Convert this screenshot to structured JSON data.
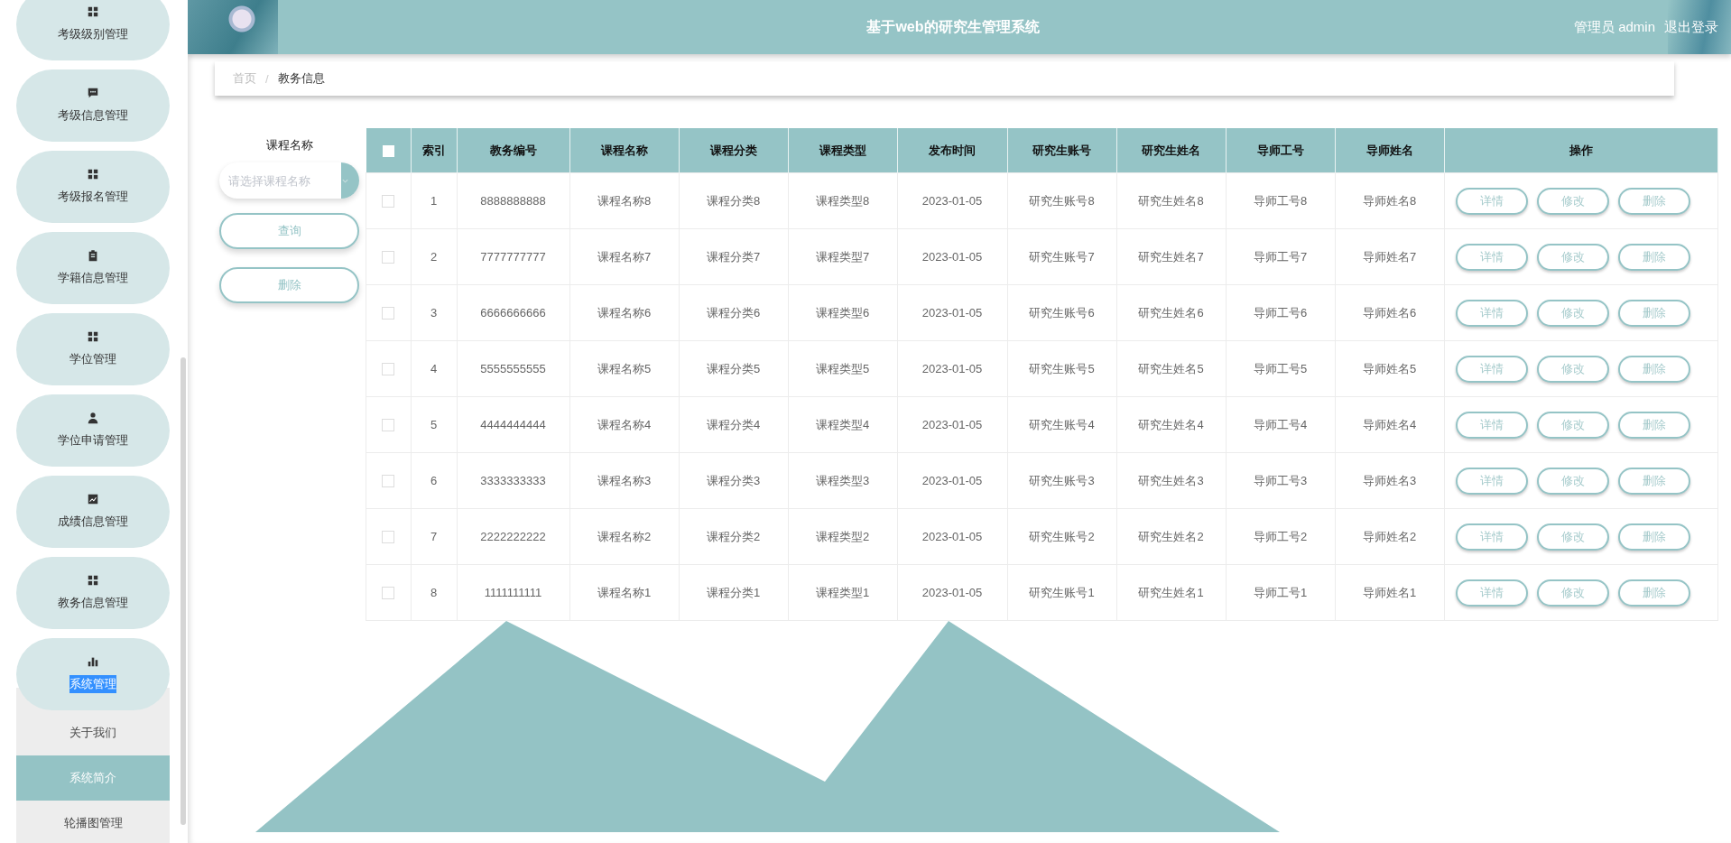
{
  "sidebar": {
    "items": [
      {
        "label": "考级级别管理",
        "kind": "grid",
        "selected": false
      },
      {
        "label": "考级信息管理",
        "kind": "chat",
        "selected": false
      },
      {
        "label": "考级报名管理",
        "kind": "grid",
        "selected": false
      },
      {
        "label": "学籍信息管理",
        "kind": "clipboard",
        "selected": false
      },
      {
        "label": "学位管理",
        "kind": "grid",
        "selected": false
      },
      {
        "label": "学位申请管理",
        "kind": "person",
        "selected": false
      },
      {
        "label": "成绩信息管理",
        "kind": "trend",
        "selected": false
      },
      {
        "label": "教务信息管理",
        "kind": "grid",
        "selected": false
      },
      {
        "label": "系统管理",
        "kind": "bars",
        "selected": true,
        "expanded": true,
        "children": [
          {
            "label": "关于我们",
            "selected": false
          },
          {
            "label": "系统简介",
            "selected": true
          },
          {
            "label": "轮播图管理",
            "selected": false
          }
        ]
      }
    ]
  },
  "header": {
    "title": "基于web的研究生管理系统",
    "user": "管理员 admin",
    "logout": "退出登录"
  },
  "breadcrumb": {
    "separator": "/",
    "items": [
      "首页",
      "教务信息"
    ]
  },
  "search": {
    "label": "课程名称",
    "placeholder": "请选择课程名称",
    "buttons": [
      "查询",
      "删除"
    ]
  },
  "table": {
    "select_all_checked": false,
    "columns": [
      "索引",
      "教务编号",
      "课程名称",
      "课程分类",
      "课程类型",
      "发布时间",
      "研究生账号",
      "研究生姓名",
      "导师工号",
      "导师姓名",
      "操作"
    ],
    "rows": [
      {
        "checked": false,
        "cells": [
          "1",
          "8888888888",
          "课程名称8",
          "课程分类8",
          "课程类型8",
          "2023-01-05",
          "研究生账号8",
          "研究生姓名8",
          "导师工号8",
          "导师姓名8"
        ],
        "actions": [
          "详情",
          "修改",
          "删除"
        ]
      },
      {
        "checked": false,
        "cells": [
          "2",
          "7777777777",
          "课程名称7",
          "课程分类7",
          "课程类型7",
          "2023-01-05",
          "研究生账号7",
          "研究生姓名7",
          "导师工号7",
          "导师姓名7"
        ],
        "actions": [
          "详情",
          "修改",
          "删除"
        ]
      },
      {
        "checked": false,
        "cells": [
          "3",
          "6666666666",
          "课程名称6",
          "课程分类6",
          "课程类型6",
          "2023-01-05",
          "研究生账号6",
          "研究生姓名6",
          "导师工号6",
          "导师姓名6"
        ],
        "actions": [
          "详情",
          "修改",
          "删除"
        ]
      },
      {
        "checked": false,
        "cells": [
          "4",
          "5555555555",
          "课程名称5",
          "课程分类5",
          "课程类型5",
          "2023-01-05",
          "研究生账号5",
          "研究生姓名5",
          "导师工号5",
          "导师姓名5"
        ],
        "actions": [
          "详情",
          "修改",
          "删除"
        ]
      },
      {
        "checked": false,
        "cells": [
          "5",
          "4444444444",
          "课程名称4",
          "课程分类4",
          "课程类型4",
          "2023-01-05",
          "研究生账号4",
          "研究生姓名4",
          "导师工号4",
          "导师姓名4"
        ],
        "actions": [
          "详情",
          "修改",
          "删除"
        ]
      },
      {
        "checked": false,
        "cells": [
          "6",
          "3333333333",
          "课程名称3",
          "课程分类3",
          "课程类型3",
          "2023-01-05",
          "研究生账号3",
          "研究生姓名3",
          "导师工号3",
          "导师姓名3"
        ],
        "actions": [
          "详情",
          "修改",
          "删除"
        ]
      },
      {
        "checked": false,
        "cells": [
          "7",
          "2222222222",
          "课程名称2",
          "课程分类2",
          "课程类型2",
          "2023-01-05",
          "研究生账号2",
          "研究生姓名2",
          "导师工号2",
          "导师姓名2"
        ],
        "actions": [
          "详情",
          "修改",
          "删除"
        ]
      },
      {
        "checked": false,
        "cells": [
          "8",
          "1111111111",
          "课程名称1",
          "课程分类1",
          "课程类型1",
          "2023-01-05",
          "研究生账号1",
          "研究生姓名1",
          "导师工号1",
          "导师姓名1"
        ],
        "actions": [
          "详情",
          "修改",
          "删除"
        ]
      }
    ]
  }
}
